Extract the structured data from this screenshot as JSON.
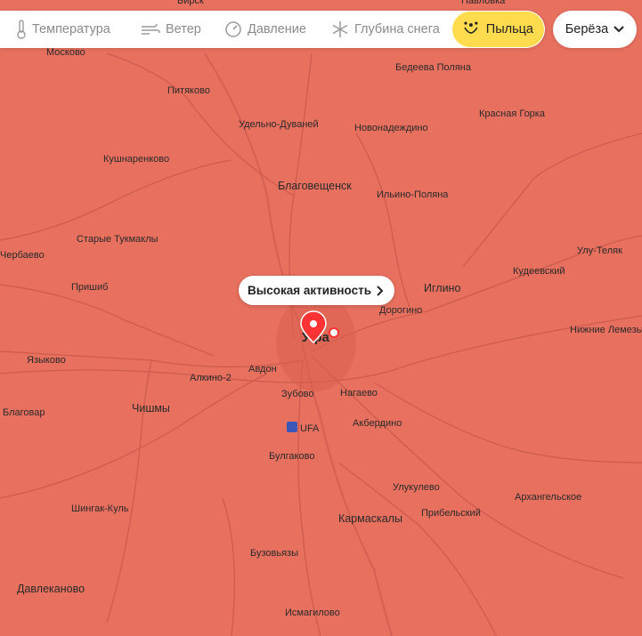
{
  "toolbar": {
    "layers": [
      {
        "label": "Температура",
        "icon": "thermometer-icon"
      },
      {
        "label": "Ветер",
        "icon": "wind-icon"
      },
      {
        "label": "Давление",
        "icon": "pressure-icon"
      },
      {
        "label": "Глубина снега",
        "icon": "snowflake-icon"
      },
      {
        "label": "Пыльца",
        "icon": "pollen-icon",
        "active": true
      }
    ],
    "species": "Берёза",
    "active_color": "#ffdb4d"
  },
  "map": {
    "fill_color": "#e8705f",
    "activity_label": "Высокая активность",
    "city_marker": "Уфа",
    "airport_label": "UFA",
    "places": [
      {
        "name": "Бирск"
      },
      {
        "name": "Павловка"
      },
      {
        "name": "Москово"
      },
      {
        "name": "Бедеева Поляна"
      },
      {
        "name": "Питяково"
      },
      {
        "name": "Удельно-Дуваней"
      },
      {
        "name": "Новонадеждино"
      },
      {
        "name": "Красная Горка"
      },
      {
        "name": "Кушнаренково"
      },
      {
        "name": "Благовещенск"
      },
      {
        "name": "Ильино-Поляна"
      },
      {
        "name": "Старые Тукмаклы"
      },
      {
        "name": "Улу-Теляк"
      },
      {
        "name": "Чербаево"
      },
      {
        "name": "Кудеевский"
      },
      {
        "name": "Пришиб"
      },
      {
        "name": "Иглино"
      },
      {
        "name": "Дорогино"
      },
      {
        "name": "Нижние Лемезы"
      },
      {
        "name": "Языково"
      },
      {
        "name": "Алкино-2"
      },
      {
        "name": "Авдон"
      },
      {
        "name": "Зубово"
      },
      {
        "name": "Нагаево"
      },
      {
        "name": "Благовар"
      },
      {
        "name": "Чишмы"
      },
      {
        "name": "Акбердино"
      },
      {
        "name": "Булгаково"
      },
      {
        "name": "Улукулево"
      },
      {
        "name": "Шингак-Куль"
      },
      {
        "name": "Прибельский"
      },
      {
        "name": "Архангельское"
      },
      {
        "name": "Кармаскалы"
      },
      {
        "name": "Бузовьязы"
      },
      {
        "name": "Давлеканово"
      },
      {
        "name": "Исмагилово"
      }
    ]
  }
}
